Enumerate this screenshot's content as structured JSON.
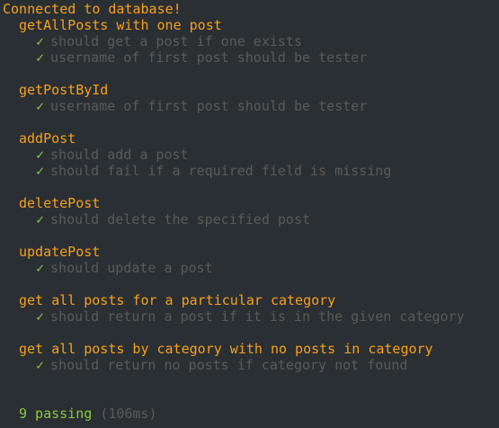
{
  "terminal": {
    "connected_message": "Connected to database!",
    "suites": [
      {
        "title": "getAllPosts with one post",
        "tests": [
          "should get a post if one exists",
          "username of first post should be tester"
        ]
      },
      {
        "title": "getPostById",
        "tests": [
          "username of first post should be tester"
        ]
      },
      {
        "title": "addPost",
        "tests": [
          "should add a post",
          "should fail if a required field is missing"
        ]
      },
      {
        "title": "deletePost",
        "tests": [
          "should delete the specified post"
        ]
      },
      {
        "title": "updatePost",
        "tests": [
          "should update a post"
        ]
      },
      {
        "title": "get all posts for a particular category",
        "tests": [
          "should return a post if it is in the given category"
        ]
      },
      {
        "title": "get all posts by category with no posts in category",
        "tests": [
          "should return no posts if category not found"
        ]
      }
    ],
    "check_glyph": "✓",
    "summary": {
      "passing": "9 passing",
      "duration": "(106ms)"
    },
    "colors": {
      "background": "#2a2f33",
      "suite": "#f5a020",
      "check": "#7ac943",
      "test_text": "#5a5a5a",
      "passing": "#8ac641"
    }
  }
}
